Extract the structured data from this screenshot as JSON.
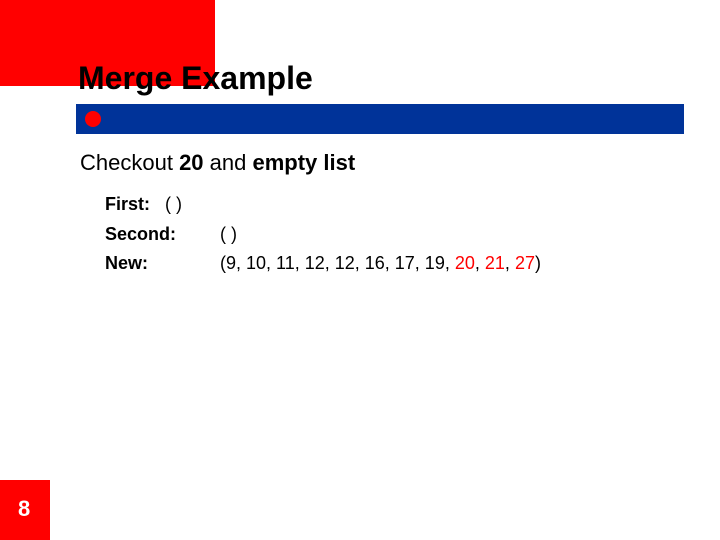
{
  "title": "Merge Example",
  "subtitle": {
    "prefix": "Checkout ",
    "num": "20",
    "mid": " and ",
    "phrase": "empty list"
  },
  "rows": {
    "first": {
      "label": "First:",
      "value": "( )"
    },
    "second": {
      "label": "Second:",
      "value": "( )"
    },
    "new": {
      "label": "New:",
      "prefix": "(9, 10, 11, 12, 12, 16, 17, 19, ",
      "h1": "20",
      "sep1": ", ",
      "h2": "21",
      "sep2": ", ",
      "h3": "27",
      "suffix": ")"
    }
  },
  "page": "8"
}
